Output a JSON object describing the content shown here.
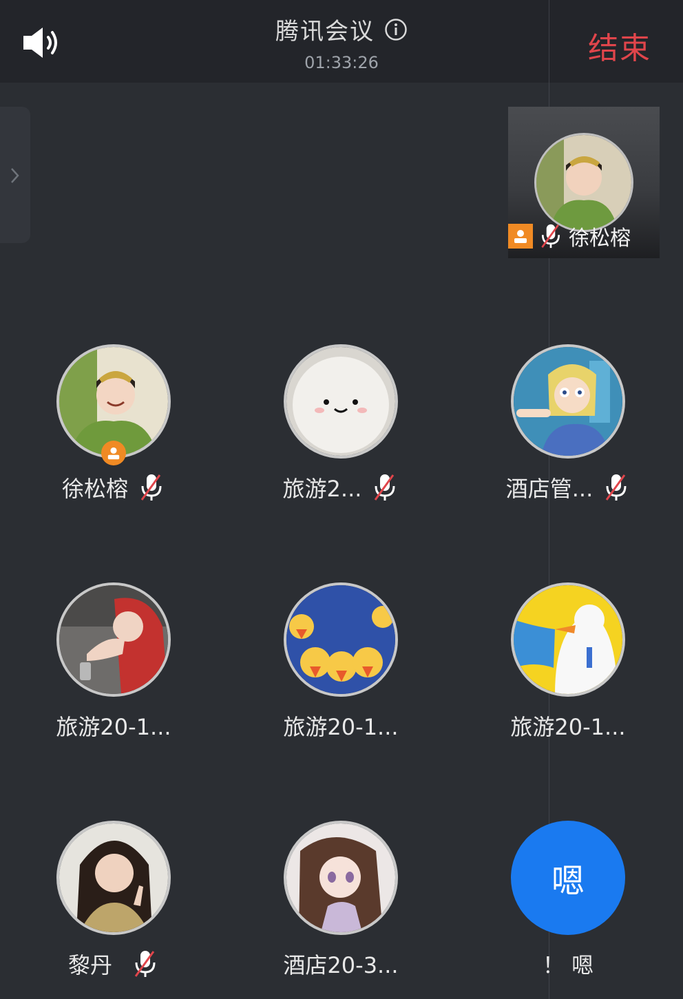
{
  "header": {
    "title": "腾讯会议",
    "timer": "01:33:26",
    "end_label": "结束"
  },
  "preview": {
    "name": "徐松榕"
  },
  "participants": [
    {
      "name": "徐松榕",
      "muted": true,
      "host": true
    },
    {
      "name": "旅游2...",
      "muted": true,
      "host": false
    },
    {
      "name": "酒店管...",
      "muted": true,
      "host": false
    },
    {
      "name": "旅游20-1...",
      "muted": false,
      "host": false
    },
    {
      "name": "旅游20-1...",
      "muted": false,
      "host": false
    },
    {
      "name": "旅游20-1...",
      "muted": false,
      "host": false
    },
    {
      "name": "黎丹",
      "muted": true,
      "host": false
    },
    {
      "name": "酒店20-3...",
      "muted": false,
      "host": false
    },
    {
      "name": "！ 嗯",
      "muted": false,
      "host": false,
      "avatar_text": "嗯"
    }
  ],
  "colors": {
    "background": "#2b2e33",
    "topbar": "#23252a",
    "end_red": "#e0454b",
    "host_orange": "#f08a24",
    "text_avatar_blue": "#1a7af0"
  },
  "icons": [
    "speaker-icon",
    "info-icon",
    "chevron-right-icon",
    "mic-muted-icon",
    "host-icon"
  ]
}
